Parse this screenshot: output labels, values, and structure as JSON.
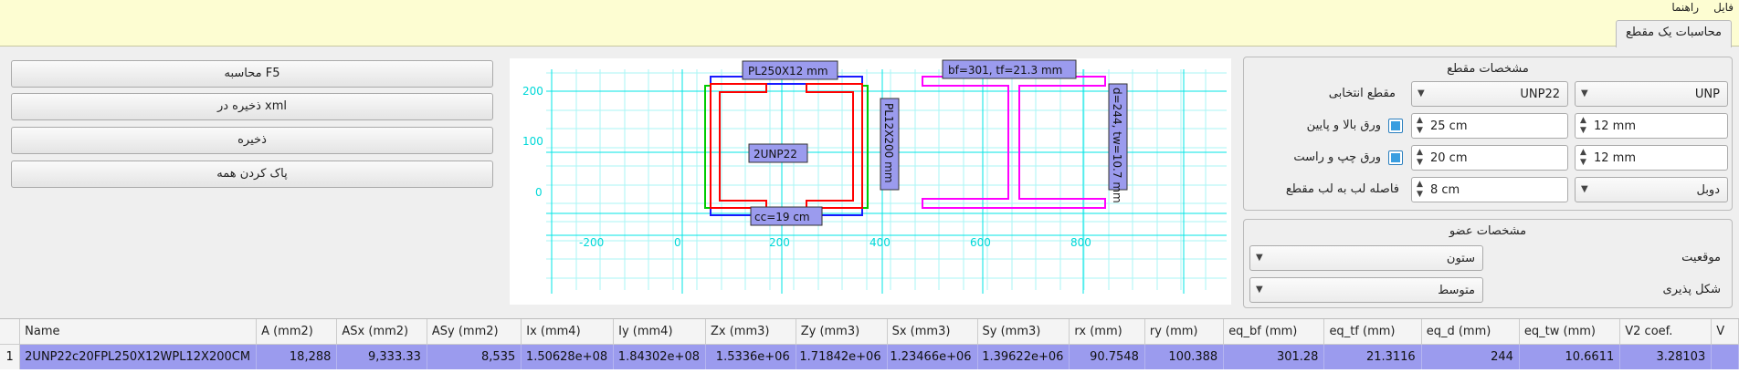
{
  "menu": {
    "file": "فایل",
    "help": "راهنما"
  },
  "tab": {
    "label": "محاسبات یک مقطع"
  },
  "buttons": {
    "calc": "محاسبه F5",
    "save_xml": "ذخیره در xml",
    "save": "ذخیره",
    "clear": "پاک کردن همه"
  },
  "section": {
    "title": "مشخصات مقطع",
    "profile_type": "UNP",
    "profile": "UNP22",
    "selected_label": "مقطع انتخابی",
    "tb_thickness": "12 mm",
    "tb_width": "25 cm",
    "tb_label": "ورق بالا و پایین",
    "tb_checked": true,
    "lr_thickness": "12 mm",
    "lr_width": "20 cm",
    "lr_label": "ورق چپ و راست",
    "lr_checked": true,
    "arrangement": "دوبل",
    "gap": "8 cm",
    "gap_label": "فاصله لب به لب مقطع"
  },
  "member": {
    "title": "مشخصات عضو",
    "position_label": "موقعیت",
    "position": "ستون",
    "ductility_label": "شکل پذیری",
    "ductility": "متوسط"
  },
  "plot": {
    "x_ticks": [
      "-200",
      "0",
      "200",
      "400",
      "600",
      "800"
    ],
    "y_ticks": [
      "0",
      "100",
      "200"
    ],
    "labels": {
      "top_plate": "PL250X12 mm",
      "section": "2UNP22",
      "side_plate": "PL12X200 mm",
      "cc": "cc=19 cm",
      "bf": "bf=301, tf=21.3 mm",
      "d": "d=244, tw=10.7 mm"
    },
    "colors": {
      "plate_tb": "#1a1aff",
      "plate_lr": "#00cc00",
      "channel": "#ff0000",
      "equiv": "#ff00ff",
      "grid": "#aaf5f5",
      "axis": "#00e5e5",
      "label_bg": "#9b9bee"
    }
  },
  "table": {
    "headers": [
      "Name",
      "A (mm2)",
      "ASx (mm2)",
      "ASy (mm2)",
      "Ix (mm4)",
      "Iy (mm4)",
      "Zx (mm3)",
      "Zy (mm3)",
      "Sx (mm3)",
      "Sy (mm3)",
      "rx (mm)",
      "ry (mm)",
      "eq_bf (mm)",
      "eq_tf (mm)",
      "eq_d (mm)",
      "eq_tw (mm)",
      "V2 coef.",
      "V"
    ],
    "rows": [
      {
        "index": "1",
        "cells": [
          "2UNP22c20FPL250X12WPL12X200CM",
          "18,288",
          "9,333.33",
          "8,535",
          "1.50628e+08",
          "1.84302e+08",
          "1.5336e+06",
          "1.71842e+06",
          "1.23466e+06",
          "1.39622e+06",
          "90.7548",
          "100.388",
          "301.28",
          "21.3116",
          "244",
          "10.6611",
          "3.28103",
          ""
        ]
      }
    ]
  }
}
